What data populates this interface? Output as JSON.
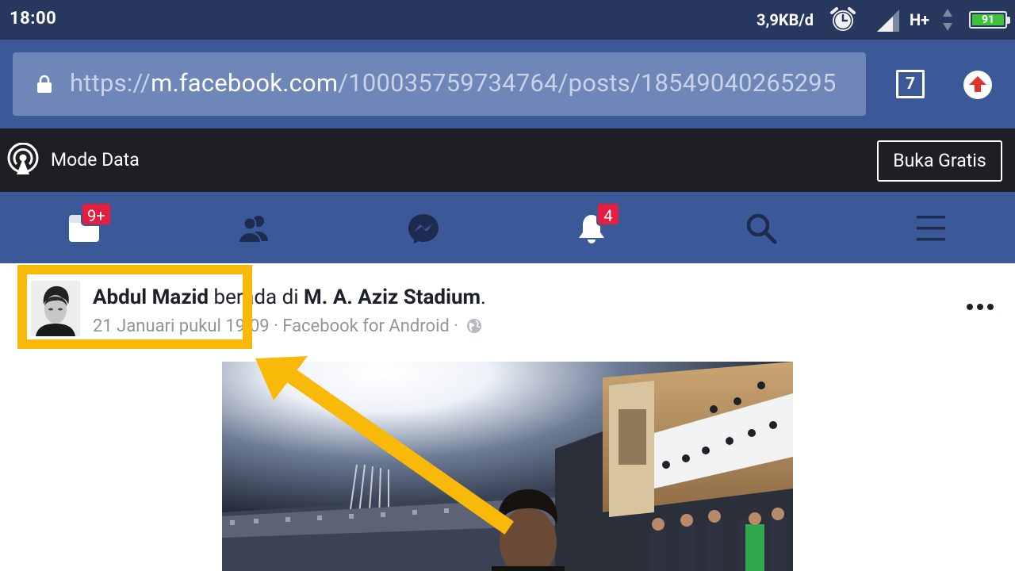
{
  "status_bar": {
    "time": "18:00",
    "speed": "3,9KB/d",
    "network": "H+",
    "battery": "91",
    "icons": [
      "alarm-icon",
      "signal-icon",
      "data-arrows-icon",
      "battery-icon"
    ]
  },
  "browser": {
    "url_scheme": "https://",
    "url_host": "m.facebook.com",
    "url_path": "/100035759734764/posts/18549040265295",
    "tab_count": "7",
    "icons": [
      "lock-icon",
      "upload-icon"
    ]
  },
  "data_mode": {
    "label": "Mode Data",
    "button": "Buka Gratis",
    "icon": "broadcast-icon"
  },
  "fb_nav": {
    "items": [
      {
        "name": "news-feed",
        "icon": "news-feed-icon",
        "badge": "9+"
      },
      {
        "name": "friends",
        "icon": "friends-icon",
        "badge": ""
      },
      {
        "name": "messenger",
        "icon": "messenger-icon",
        "badge": ""
      },
      {
        "name": "notifications",
        "icon": "bell-icon",
        "badge": "4"
      },
      {
        "name": "search",
        "icon": "search-icon",
        "badge": ""
      },
      {
        "name": "menu",
        "icon": "menu-icon",
        "badge": ""
      }
    ]
  },
  "post": {
    "author": "Abdul Mazid",
    "action": " berada di ",
    "place": "M. A. Aziz Stadium",
    "place_suffix": ".",
    "meta": "21 Januari pukul 19.09 · Facebook for Android · ",
    "icons": [
      "globe-icon",
      "more-icon"
    ]
  },
  "colors": {
    "facebook_blue": "#3b5998",
    "status_bar": "#27375e",
    "data_bar": "#1d1f22",
    "badge_red": "#e41e3f",
    "annotation_yellow": "#f8b908"
  }
}
